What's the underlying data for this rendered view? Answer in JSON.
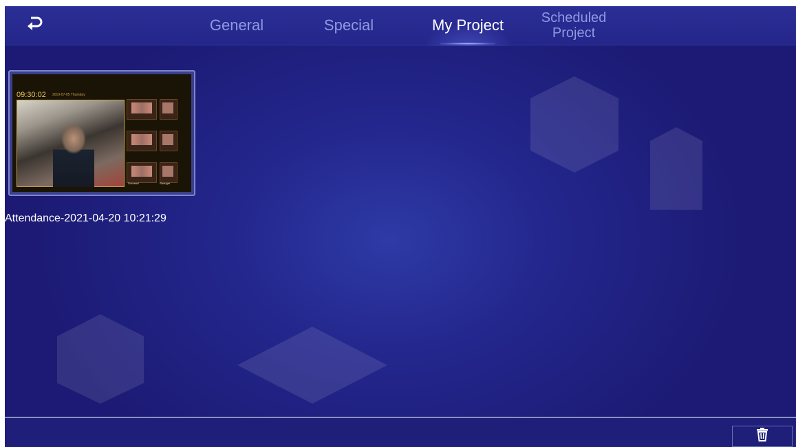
{
  "header": {
    "back_icon": "return-arrow-icon",
    "tabs": [
      {
        "label": "General",
        "active": false
      },
      {
        "label": "Special",
        "active": false
      },
      {
        "label": "My Project",
        "active": true
      },
      {
        "label_line1": "Scheduled",
        "label_line2": "Project",
        "active": false
      }
    ]
  },
  "projects": [
    {
      "name": "Attendance-2021-04-20 10:21:29",
      "thumbnail": {
        "time": "09:30:02",
        "date": "2019-07-05 Thursday",
        "tile_labels": [
          "Success!",
          "Stranger"
        ]
      }
    }
  ],
  "footer": {
    "delete_icon": "trash-icon"
  },
  "colors": {
    "background": "#1c1a74",
    "tab_inactive": "#8e9be0",
    "tab_active": "#ffffff",
    "thumb_accent": "#e8c455"
  }
}
